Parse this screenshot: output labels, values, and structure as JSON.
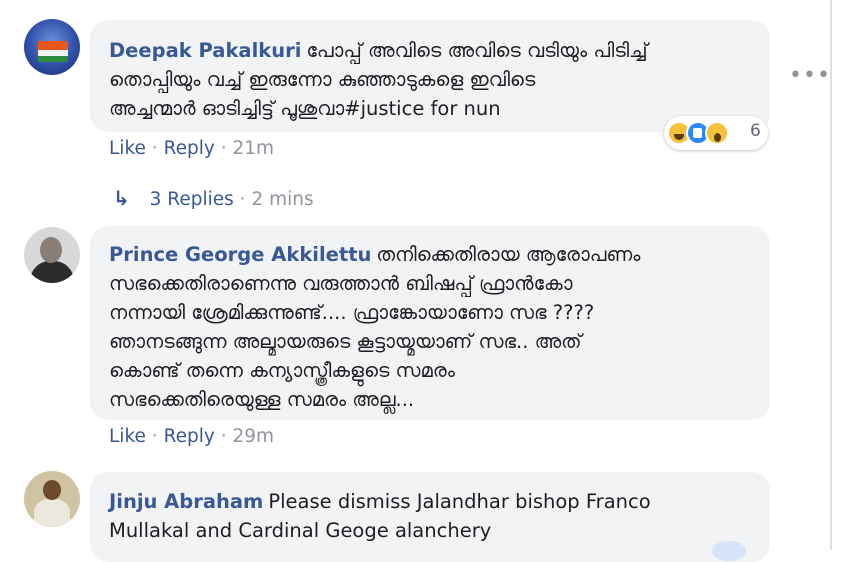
{
  "comments": [
    {
      "author": "Deepak Pakalkuri",
      "lines": [
        "പോപ്പ് അവിടെ അവിടെ വടിയും പിടിച്ച്",
        "തൊപ്പിയും വച്ച് ഇരുന്നോ കുഞ്ഞാടുകളെ ഇവിടെ",
        "അച്ചന്മാർ ഓടിച്ചിട്ട് പൂശുവാ#justice for nun"
      ],
      "like": "Like",
      "reply": "Reply",
      "time": "21m",
      "reaction_count": "6",
      "reaction_icons": [
        "haha-icon",
        "like-icon",
        "wow-icon"
      ]
    },
    {
      "author": "Prince George Akkilettu",
      "lines": [
        "തനിക്കെതിരായ ആരോപണം",
        "സഭക്കെതിരാണെന്നു വരുത്താൻ ബിഷപ്പ് ഫ്രാൻകോ",
        "നന്നായി ശ്രേമിക്കുന്നുണ്ട്.... ഫ്രാങ്കോയാണോ സഭ ????",
        "ഞാനടങ്ങുന്ന അല്മായരുടെ കൂട്ടായ്മയാണ് സഭ.. അത്",
        "കൊണ്ട് തന്നെ കന്യാസ്ത്രീകളുടെ സമരം",
        "സഭക്കെതിരെയുള്ള സമരം അല്ല..."
      ],
      "like": "Like",
      "reply": "Reply",
      "time": "29m"
    },
    {
      "author": "Jinju Abraham",
      "lines": [
        "Please dismiss Jalandhar bishop Franco",
        "Mullakal and Cardinal Geoge alanchery"
      ]
    }
  ],
  "replies": {
    "label": "3 Replies",
    "time": "2 mins"
  },
  "separator": "·",
  "more_label": "•••",
  "colors": {
    "link": "#385898",
    "bubble": "#f2f3f5",
    "muted": "#90949c"
  }
}
